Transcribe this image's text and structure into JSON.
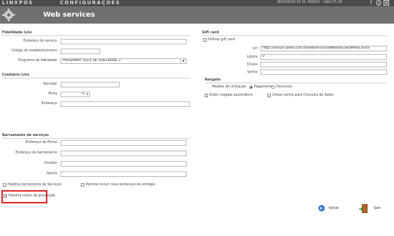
{
  "topbar": {
    "logo": "LINXPOS",
    "app_title": "CONFIGURAÇÕES",
    "status": "28/12/2016 15:31, 000051 - LOJA ETL SP",
    "icons": [
      "help-icon",
      "info-icon",
      "close-icon"
    ]
  },
  "header": {
    "title": "Web services",
    "icon": "gear-icon"
  },
  "fidelidade": {
    "title": "Fidelidade Linx",
    "endereco_label": "Endereço do serviço",
    "endereco_value": "",
    "codigo_label": "Código do estabelecimento",
    "codigo_value": "",
    "programa_label": "Programa de fidelidade",
    "programa_value": "PROGRAMA TESTE DE FIDELIDADE 2"
  },
  "crediario": {
    "title": "Crediário Linx",
    "servidor_label": "Servidor",
    "servidor_value": "",
    "porta_label": "Porta",
    "porta_value": "0",
    "endereco_label": "Endereço",
    "endereco_value": ""
  },
  "barramento": {
    "title": "Barramento de serviços",
    "portal_label": "Endereço do Portal",
    "portal_value": "",
    "barramento_label": "Endereço do barramento",
    "barramento_value": "",
    "usuario_label": "Usuário",
    "usuario_value": "",
    "senha_label": "Senha",
    "senha_value": "",
    "habilita_label": "Habilita barramento de Serviços",
    "permite_label": "Permite incluir novo endereço de entrega",
    "motor_label": "Habilita motor de promoção"
  },
  "giftcard": {
    "title": "Gift card",
    "utilizar_label": "Utilizar gift card",
    "url_label": "Url",
    "url_value": "https://secure.peela.com.br/webservice2/WebSite1/wsdPeela.asmx",
    "loja_label": "Lojista",
    "loja_value": "0",
    "chave_label": "Chave",
    "chave_value": "",
    "senha_label": "Senha",
    "senha_value": ""
  },
  "resgate": {
    "title": "Resgate",
    "modelo_label": "Modelo de utilização",
    "opt_pagamento": "Pagamento",
    "opt_desconto": "Desconto",
    "exibir_label": "Exibir resgate automático",
    "utiliza_senha_label": "Utiliza senha para Consulta de Saldo"
  },
  "actions": {
    "voltar": "Voltar",
    "sair": "Sair"
  },
  "colors": {
    "header_bg": "#707070",
    "topbar_bg": "#4a4a4a",
    "highlight": "#e02020"
  }
}
